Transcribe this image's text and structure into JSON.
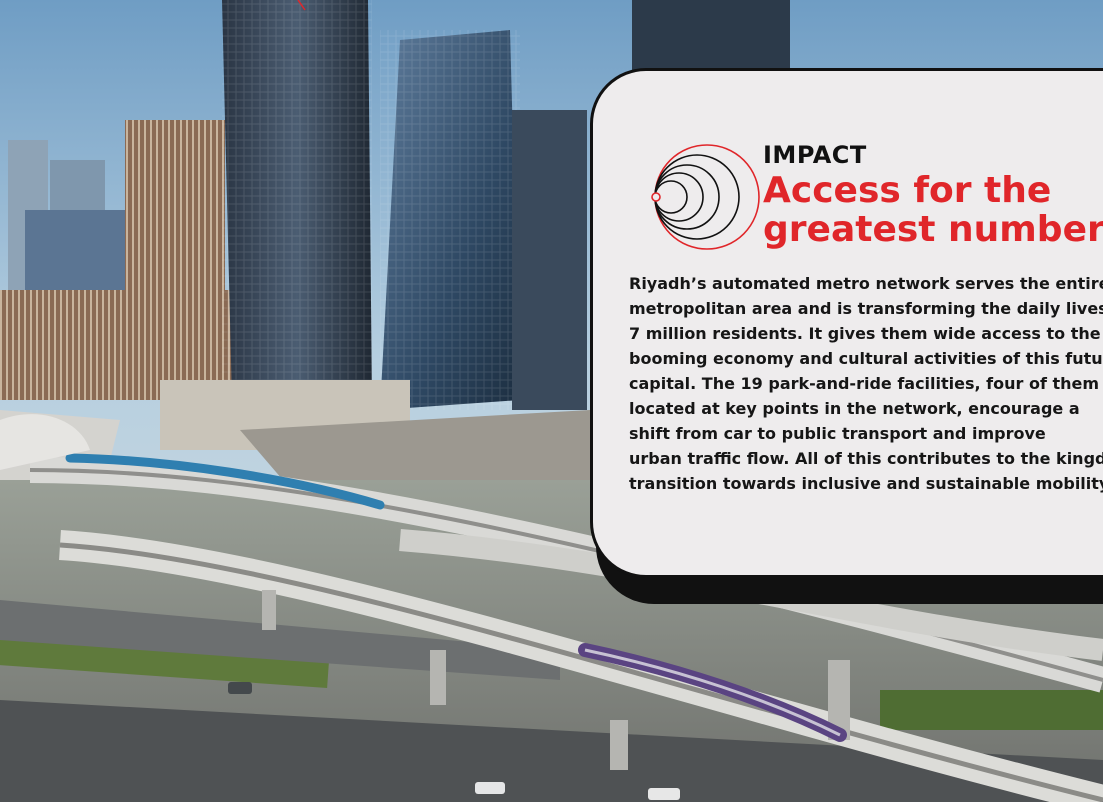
{
  "article": {
    "eyebrow": "IMPACT",
    "headline_lines": [
      "Access for the",
      "greatest number"
    ],
    "body_lines": [
      "Riyadh’s automated metro network serves the entire",
      "metropolitan area and is transforming the daily lives of",
      "7 million residents. It gives them wide access to the",
      "booming economy and cultural activities of this future",
      "capital. The 19 park-and-ride facilities, four of them",
      "located at key points in the network, encourage a",
      "shift from car to public transport and improve",
      "urban traffic flow. All of this contributes to the kingdom’s",
      "transition towards inclusive and sustainable mobility."
    ]
  },
  "colors": {
    "accent": "#e0262a",
    "card_background": "#eeeced",
    "card_border": "#111111",
    "text": "#161616"
  },
  "icons": {
    "logo": "concentric-circles-icon"
  }
}
